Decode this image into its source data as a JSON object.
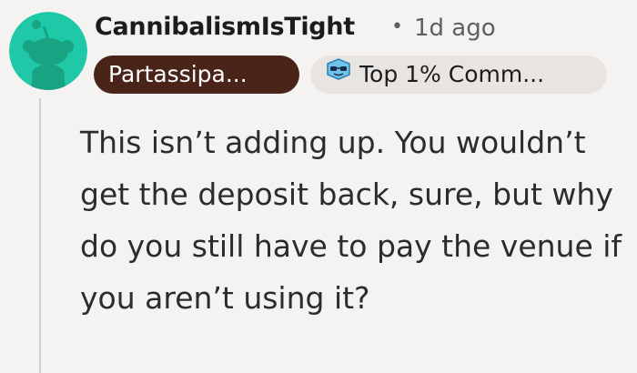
{
  "comment": {
    "username": "CannibalismIsTight",
    "separator": "•",
    "timestamp": "1d ago",
    "flair_user": "Partassipa...",
    "flair_top": "Top 1% Comm...",
    "body": "This isn’t adding up. You wouldn’t get the deposit back, sure, but why do you still have to pay the venue if you aren’t using it?"
  },
  "icons": {
    "avatar": "snoo-avatar-icon",
    "badge": "top-commenter-badge-icon"
  },
  "colors": {
    "avatar_bg": "#1fc9a8",
    "avatar_figure": "#18a383",
    "flair_user_bg": "#4a2418",
    "flair_top_bg": "#e8e4e1",
    "page_bg": "#f5f3f2"
  }
}
